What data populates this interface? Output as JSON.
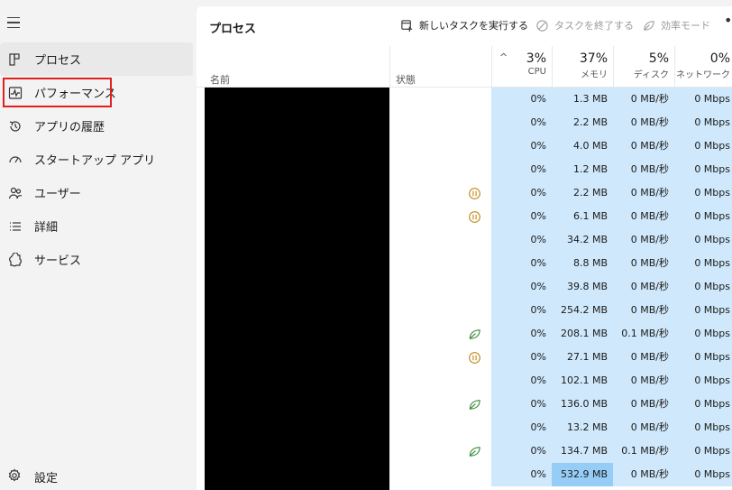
{
  "sidebar": {
    "items": [
      {
        "label": "プロセス",
        "icon": "processes-icon"
      },
      {
        "label": "パフォーマンス",
        "icon": "performance-icon"
      },
      {
        "label": "アプリの履歴",
        "icon": "history-icon"
      },
      {
        "label": "スタートアップ アプリ",
        "icon": "startup-icon"
      },
      {
        "label": "ユーザー",
        "icon": "users-icon"
      },
      {
        "label": "詳細",
        "icon": "details-icon"
      },
      {
        "label": "サービス",
        "icon": "services-icon"
      }
    ],
    "settings_label": "設定"
  },
  "toolbar": {
    "title": "プロセス",
    "new_task": "新しいタスクを実行する",
    "end_task": "タスクを終了する",
    "efficiency": "効率モード",
    "more": "•"
  },
  "header": {
    "name": "名前",
    "status": "状態",
    "cpu_pct": "3%",
    "cpu_label": "CPU",
    "mem_pct": "37%",
    "mem_label": "メモリ",
    "disk_pct": "5%",
    "disk_label": "ディスク",
    "net_pct": "0%",
    "net_label": "ネットワーク"
  },
  "colors": {
    "highlight_box": "#e0201c",
    "cell_bg": "#cfe8fb",
    "cell_hot": "#96cdf6",
    "paused_icon": "#c18a1a",
    "efficiency_icon": "#3a8a3a"
  },
  "rows": [
    {
      "status": "",
      "cpu": "0%",
      "mem": "1.3 MB",
      "disk": "0 MB/秒",
      "net": "0 Mbps"
    },
    {
      "status": "",
      "cpu": "0%",
      "mem": "2.2 MB",
      "disk": "0 MB/秒",
      "net": "0 Mbps"
    },
    {
      "status": "",
      "cpu": "0%",
      "mem": "4.0 MB",
      "disk": "0 MB/秒",
      "net": "0 Mbps"
    },
    {
      "status": "",
      "cpu": "0%",
      "mem": "1.2 MB",
      "disk": "0 MB/秒",
      "net": "0 Mbps"
    },
    {
      "status": "paused",
      "cpu": "0%",
      "mem": "2.2 MB",
      "disk": "0 MB/秒",
      "net": "0 Mbps"
    },
    {
      "status": "paused",
      "cpu": "0%",
      "mem": "6.1 MB",
      "disk": "0 MB/秒",
      "net": "0 Mbps"
    },
    {
      "status": "",
      "cpu": "0%",
      "mem": "34.2 MB",
      "disk": "0 MB/秒",
      "net": "0 Mbps"
    },
    {
      "status": "",
      "cpu": "0%",
      "mem": "8.8 MB",
      "disk": "0 MB/秒",
      "net": "0 Mbps"
    },
    {
      "status": "",
      "cpu": "0%",
      "mem": "39.8 MB",
      "disk": "0 MB/秒",
      "net": "0 Mbps"
    },
    {
      "status": "",
      "cpu": "0%",
      "mem": "254.2 MB",
      "disk": "0 MB/秒",
      "net": "0 Mbps"
    },
    {
      "status": "efficiency",
      "cpu": "0%",
      "mem": "208.1 MB",
      "disk": "0.1 MB/秒",
      "net": "0 Mbps"
    },
    {
      "status": "paused",
      "cpu": "0%",
      "mem": "27.1 MB",
      "disk": "0 MB/秒",
      "net": "0 Mbps"
    },
    {
      "status": "",
      "cpu": "0%",
      "mem": "102.1 MB",
      "disk": "0 MB/秒",
      "net": "0 Mbps"
    },
    {
      "status": "efficiency",
      "cpu": "0%",
      "mem": "136.0 MB",
      "disk": "0 MB/秒",
      "net": "0 Mbps"
    },
    {
      "status": "",
      "cpu": "0%",
      "mem": "13.2 MB",
      "disk": "0 MB/秒",
      "net": "0 Mbps"
    },
    {
      "status": "efficiency",
      "cpu": "0%",
      "mem": "134.7 MB",
      "disk": "0.1 MB/秒",
      "net": "0 Mbps"
    },
    {
      "status": "",
      "cpu": "0%",
      "mem": "532.9 MB",
      "disk": "0 MB/秒",
      "net": "0 Mbps",
      "hot": true
    }
  ]
}
